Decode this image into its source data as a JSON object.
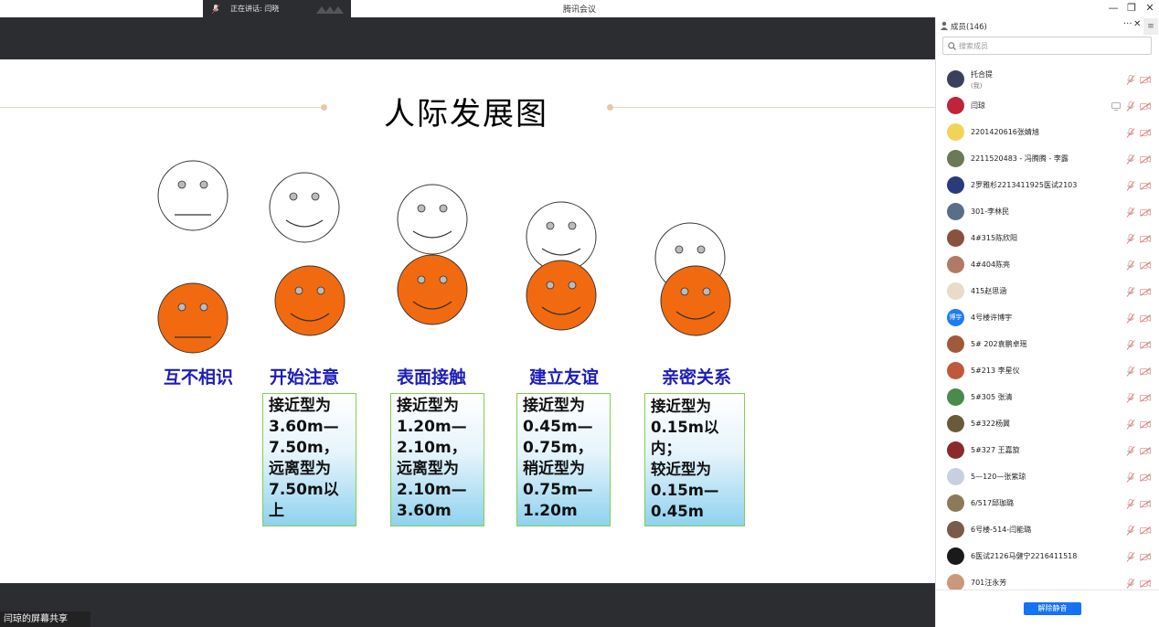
{
  "window": {
    "title": "腾讯会议",
    "speaking_label": "正在讲话: 闫晓",
    "minimize": "—",
    "restore": "❐",
    "close": "✕"
  },
  "slide": {
    "title": "人际发展图",
    "stages": [
      {
        "label": "互不相识",
        "distance": ""
      },
      {
        "label": "开始注意",
        "distance": "接近型为\n3.60m—\n7.50m，\n远离型为\n7.50m以\n上"
      },
      {
        "label": "表面接触",
        "distance": "接近型为\n1.20m—\n2.10m，\n远离型为\n2.10m—\n3.60m"
      },
      {
        "label": "建立友谊",
        "distance": "接近型为\n0.45m—\n0.75m，\n稍近型为\n0.75m—\n1.20m"
      },
      {
        "label": "亲密关系",
        "distance": "接近型为\n0.15m以内；\n较近型为\n0.15m—\n0.45m"
      }
    ],
    "face_colors": {
      "outline_face": "#ffffff",
      "orange_face": "#f26a0f"
    }
  },
  "share_tag": "闫琼的屏幕共享",
  "panel": {
    "member_count": "成员(146)",
    "more": "···",
    "close": "✕",
    "side_toggle": "≡",
    "search_placeholder": "搜索成员",
    "unmute_all": "解除静音",
    "members": [
      {
        "name": "托合提",
        "sub": "(我)",
        "avatar_color": "#3a3f5c",
        "screen": false
      },
      {
        "name": "闫琼",
        "sub": "",
        "avatar_color": "#c0243a",
        "screen": true
      },
      {
        "name": "2201420616张婧旭",
        "sub": "",
        "avatar_color": "#f2d35a",
        "screen": false
      },
      {
        "name": "2211520483 - 冯腾腾 - 李露",
        "sub": "",
        "avatar_color": "#6b7a55",
        "screen": false
      },
      {
        "name": "2罗雅杉2213411925医试2103",
        "sub": "",
        "avatar_color": "#2a3a7a",
        "screen": false
      },
      {
        "name": "301-李林民",
        "sub": "",
        "avatar_color": "#5a6e88",
        "screen": false
      },
      {
        "name": "4#315陈欣阳",
        "sub": "",
        "avatar_color": "#8a5040",
        "screen": false
      },
      {
        "name": "4#404陈亮",
        "sub": "",
        "avatar_color": "#b07a66",
        "screen": false
      },
      {
        "name": "415赵思涵",
        "sub": "",
        "avatar_color": "#e8dcc8",
        "screen": false
      },
      {
        "name": "4号楼许博宇",
        "sub": "",
        "avatar_color": "#1d7df0",
        "avatar_text": "博宇",
        "screen": false
      },
      {
        "name": "5# 202袁鹏卓瑶",
        "sub": "",
        "avatar_color": "#a05a3a",
        "screen": false
      },
      {
        "name": "5#213 李星仪",
        "sub": "",
        "avatar_color": "#c0583a",
        "screen": false
      },
      {
        "name": "5#305 张清",
        "sub": "",
        "avatar_color": "#4a8a4a",
        "screen": false
      },
      {
        "name": "5#322杨翼",
        "sub": "",
        "avatar_color": "#6a5a3a",
        "screen": false
      },
      {
        "name": "5#327 王嘉旋",
        "sub": "",
        "avatar_color": "#8a2a2a",
        "screen": false
      },
      {
        "name": "5—120—张紫琼",
        "sub": "",
        "avatar_color": "#c8d0e0",
        "screen": false
      },
      {
        "name": "6/517邱珈璐",
        "sub": "",
        "avatar_color": "#8a7a5a",
        "screen": false
      },
      {
        "name": "6号楼-514-闫能璐",
        "sub": "",
        "avatar_color": "#7a5a4a",
        "screen": false
      },
      {
        "name": "6医试2126马健宁2216411518",
        "sub": "",
        "avatar_color": "#1a1a1a",
        "screen": false
      },
      {
        "name": "701汪永芳",
        "sub": "",
        "avatar_color": "#c89a7a",
        "screen": false
      }
    ]
  }
}
